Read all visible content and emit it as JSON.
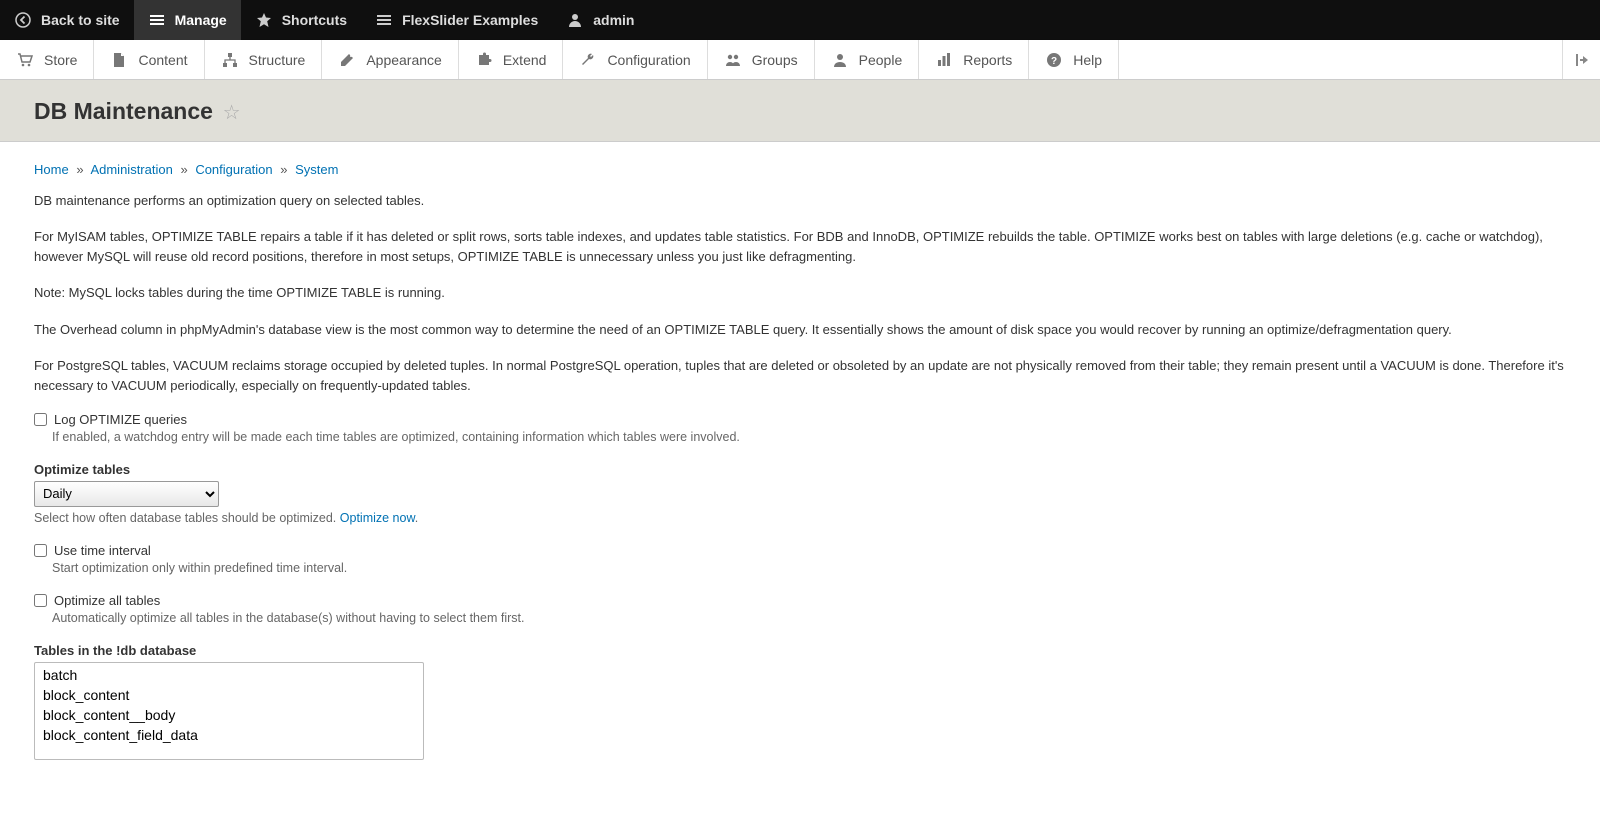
{
  "toolbar": {
    "back": "Back to site",
    "manage": "Manage",
    "shortcuts": "Shortcuts",
    "flexslider": "FlexSlider Examples",
    "user": "admin"
  },
  "secnav": {
    "store": "Store",
    "content": "Content",
    "structure": "Structure",
    "appearance": "Appearance",
    "extend": "Extend",
    "configuration": "Configuration",
    "groups": "Groups",
    "people": "People",
    "reports": "Reports",
    "help": "Help"
  },
  "page": {
    "title": "DB Maintenance"
  },
  "breadcrumb": {
    "home": "Home",
    "admin": "Administration",
    "config": "Configuration",
    "system": "System"
  },
  "paras": {
    "p1": "DB maintenance performs an optimization query on selected tables.",
    "p2": "For MyISAM tables, OPTIMIZE TABLE repairs a table if it has deleted or split rows, sorts table indexes, and updates table statistics. For BDB and InnoDB, OPTIMIZE rebuilds the table. OPTIMIZE works best on tables with large deletions (e.g. cache or watchdog), however MySQL will reuse old record positions, therefore in most setups, OPTIMIZE TABLE is unnecessary unless you just like defragmenting.",
    "p3": "Note: MySQL locks tables during the time OPTIMIZE TABLE is running.",
    "p4": "The Overhead column in phpMyAdmin's database view is the most common way to determine the need of an OPTIMIZE TABLE query. It essentially shows the amount of disk space you would recover by running an optimize/defragmentation query.",
    "p5": "For PostgreSQL tables, VACUUM reclaims storage occupied by deleted tuples. In normal PostgreSQL operation, tuples that are deleted or obsoleted by an update are not physically removed from their table; they remain present until a VACUUM is done. Therefore it's necessary to VACUUM periodically, especially on frequently-updated tables."
  },
  "form": {
    "log_label": "Log OPTIMIZE queries",
    "log_desc": "If enabled, a watchdog entry will be made each time tables are optimized, containing information which tables were involved.",
    "optimize_label": "Optimize tables",
    "optimize_value": "Daily",
    "optimize_help_prefix": "Select how often database tables should be optimized. ",
    "optimize_help_link": "Optimize now",
    "optimize_help_suffix": ".",
    "interval_label": "Use time interval",
    "interval_desc": "Start optimization only within predefined time interval.",
    "all_label": "Optimize all tables",
    "all_desc": "Automatically optimize all tables in the database(s) without having to select them first.",
    "tables_label": "Tables in the !db database",
    "tables": [
      "batch",
      "block_content",
      "block_content__body",
      "block_content_field_data"
    ]
  }
}
